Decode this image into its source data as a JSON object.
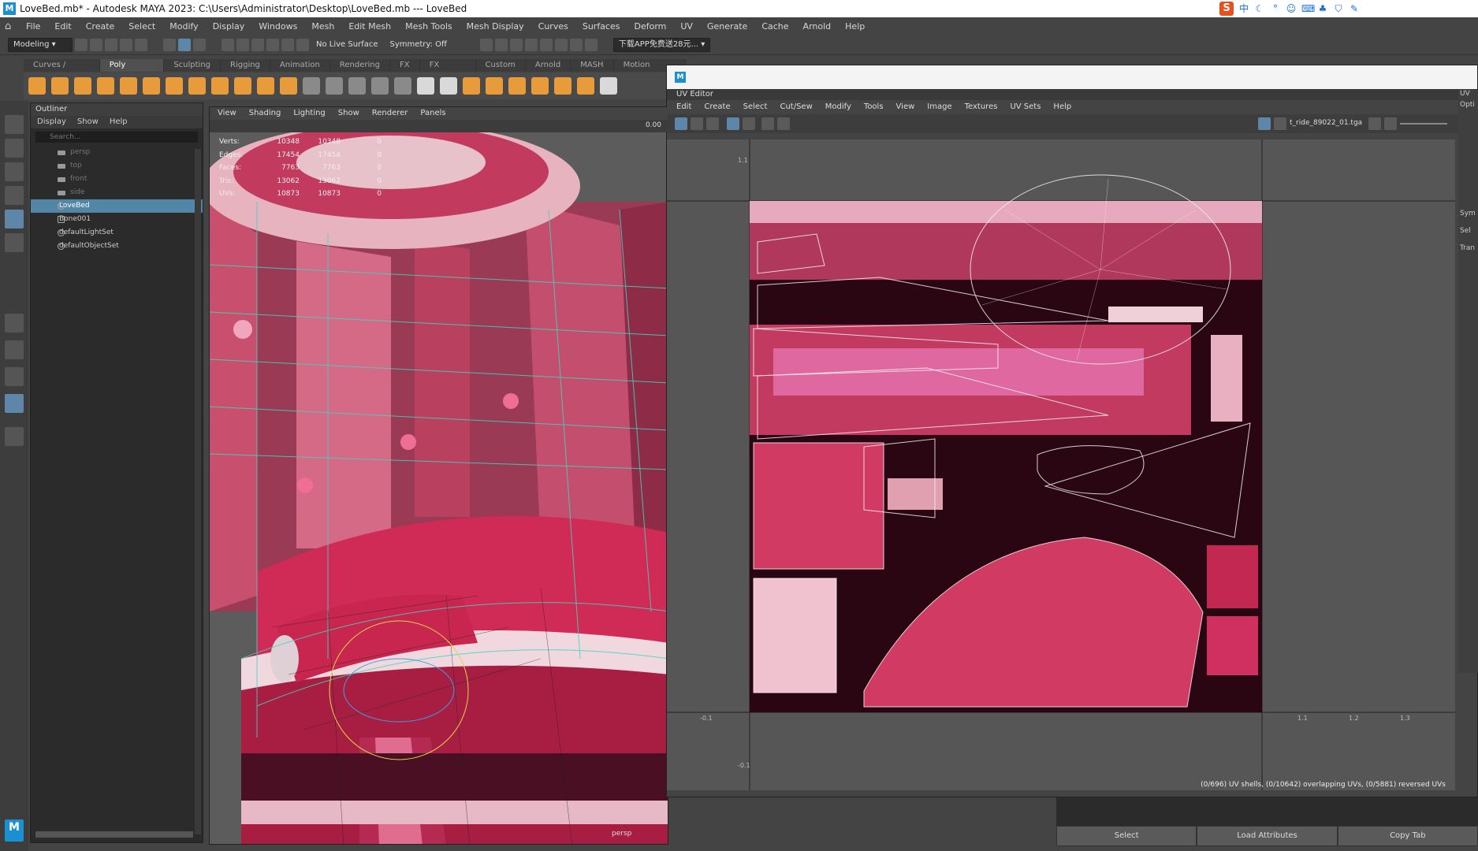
{
  "window": {
    "title": "LoveBed.mb* - Autodesk MAYA 2023: C:\\Users\\Administrator\\Desktop\\LoveBed.mb   ---   LoveBed"
  },
  "menubar": [
    "File",
    "Edit",
    "Create",
    "Select",
    "Modify",
    "Display",
    "Windows",
    "Mesh",
    "Edit Mesh",
    "Mesh Tools",
    "Mesh Display",
    "Curves",
    "Surfaces",
    "Deform",
    "UV",
    "Generate",
    "Cache",
    "Arnold",
    "Help"
  ],
  "statusline": {
    "mode": "Modeling",
    "live_surface": "No Live Surface",
    "symmetry": "Symmetry: Off",
    "workspace": "下载APP免费送28元..."
  },
  "shelf_tabs": [
    "Curves / Surfaces",
    "Poly Modeling",
    "Sculpting",
    "Rigging",
    "Animation",
    "Rendering",
    "FX",
    "FX Caching",
    "Custom",
    "Arnold",
    "MASH",
    "Motion Graphics"
  ],
  "shelf_active": "Poly Modeling",
  "outliner": {
    "title": "Outliner",
    "menu": [
      "Display",
      "Show",
      "Help"
    ],
    "search_placeholder": "Search...",
    "items": [
      {
        "label": "persp",
        "dim": true
      },
      {
        "label": "top",
        "dim": true
      },
      {
        "label": "front",
        "dim": true
      },
      {
        "label": "side",
        "dim": true
      },
      {
        "label": "LoveBed",
        "selected": true
      },
      {
        "label": "Bone001"
      },
      {
        "label": "defaultLightSet"
      },
      {
        "label": "defaultObjectSet"
      }
    ]
  },
  "viewport": {
    "menu": [
      "View",
      "Shading",
      "Lighting",
      "Show",
      "Renderer",
      "Panels"
    ],
    "field_value": "0.00",
    "camera_label": "persp",
    "hud": [
      {
        "label": "Verts:",
        "a": "10348",
        "b": "10348",
        "c": "0"
      },
      {
        "label": "Edges:",
        "a": "17454",
        "b": "17454",
        "c": "0"
      },
      {
        "label": "Faces:",
        "a": "7763",
        "b": "7763",
        "c": "0"
      },
      {
        "label": "Tris:",
        "a": "13062",
        "b": "13062",
        "c": "0"
      },
      {
        "label": "UVs:",
        "a": "10873",
        "b": "10873",
        "c": "0"
      }
    ]
  },
  "uv_editor": {
    "title": "UV Editor",
    "menu": [
      "Edit",
      "Create",
      "Select",
      "Cut/Sew",
      "Modify",
      "Tools",
      "View",
      "Image",
      "Textures",
      "UV Sets",
      "Help"
    ],
    "image_name": "t_ride_89022_01.tga",
    "status": "(0/696) UV shells, (0/10642) overlapping UVs, (0/5881) reversed UVs",
    "axis_labels": [
      "1.1",
      "-0.1",
      "1.1",
      "1.2",
      "1.3",
      "-0.1"
    ]
  },
  "right_panel": {
    "labels": [
      "UV",
      "Opti",
      "Sym",
      "Sel",
      "Tran"
    ]
  },
  "bottom_buttons": [
    "Select",
    "Load Attributes",
    "Copy Tab"
  ],
  "colors": {
    "accent": "#5285a6",
    "maya_blue": "#1b8fd1",
    "texture_pink": "#c8375e",
    "wire_cyan": "#3fd6c0"
  }
}
